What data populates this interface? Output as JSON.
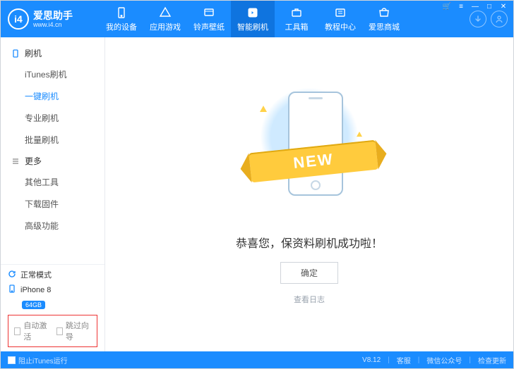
{
  "brand": {
    "name": "爱思助手",
    "site": "www.i4.cn",
    "badge": "i4"
  },
  "window_controls": {
    "cart": "🛒",
    "menu": "≡",
    "min": "—",
    "max": "□",
    "close": "✕"
  },
  "nav": [
    {
      "id": "device",
      "label": "我的设备"
    },
    {
      "id": "games",
      "label": "应用游戏"
    },
    {
      "id": "ringtone",
      "label": "铃声壁纸"
    },
    {
      "id": "flash",
      "label": "智能刷机",
      "active": true
    },
    {
      "id": "toolbox",
      "label": "工具箱"
    },
    {
      "id": "tutorial",
      "label": "教程中心"
    },
    {
      "id": "store",
      "label": "爱思商城"
    }
  ],
  "sidebar": {
    "groups": [
      {
        "title": "刷机",
        "icon": "phone",
        "items": [
          {
            "id": "itunes",
            "label": "iTunes刷机"
          },
          {
            "id": "onekey",
            "label": "一键刷机",
            "active": true
          },
          {
            "id": "pro",
            "label": "专业刷机"
          },
          {
            "id": "batch",
            "label": "批量刷机"
          }
        ]
      },
      {
        "title": "更多",
        "icon": "list",
        "items": [
          {
            "id": "other",
            "label": "其他工具"
          },
          {
            "id": "fw",
            "label": "下载固件"
          },
          {
            "id": "adv",
            "label": "高级功能"
          }
        ]
      }
    ],
    "mode": "正常模式",
    "device": {
      "name": "iPhone 8",
      "capacity": "64GB"
    },
    "checks": [
      {
        "id": "auto_activate",
        "label": "自动激活"
      },
      {
        "id": "skip_wizard",
        "label": "跳过向导"
      }
    ]
  },
  "main": {
    "ribbon": "NEW",
    "success_text": "恭喜您，保资料刷机成功啦！",
    "ok_label": "确定",
    "log_link": "查看日志"
  },
  "footer": {
    "block_itunes": "阻止iTunes运行",
    "version": "V8.12",
    "support": "客服",
    "wechat": "微信公众号",
    "update": "检查更新"
  }
}
